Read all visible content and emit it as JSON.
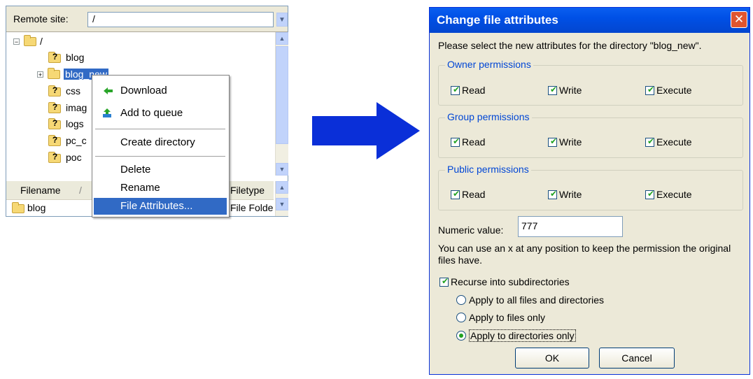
{
  "filezilla": {
    "remote_site_label": "Remote site:",
    "remote_site_value": "/",
    "tree": [
      {
        "label": "/",
        "expander": "−"
      },
      {
        "label": "blog"
      },
      {
        "label": "blog_new",
        "expander": "+",
        "selected": true
      },
      {
        "label": "css"
      },
      {
        "label": "imag"
      },
      {
        "label": "logs"
      },
      {
        "label": "pc_c"
      },
      {
        "label": "poc"
      }
    ],
    "columns": {
      "filename": "Filename",
      "sort_indicator": "/",
      "filetype": "Filetype"
    },
    "rows": [
      {
        "filename": "blog",
        "filetype": "File Folde"
      }
    ]
  },
  "context_menu": {
    "items": [
      {
        "label": "Download",
        "icon": "download-arrow-icon"
      },
      {
        "label": "Add to queue",
        "icon": "add-to-queue-icon"
      },
      {
        "label": "Create directory"
      },
      {
        "label": "Delete"
      },
      {
        "label": "Rename"
      },
      {
        "label": "File Attributes...",
        "highlighted": true
      }
    ]
  },
  "arrow": {
    "color": "#0a2fd8",
    "icon": "right-arrow-icon"
  },
  "dialog": {
    "title": "Change file attributes",
    "close_label": "✕",
    "description": "Please select the new attributes for the directory \"blog_new\".",
    "groups": [
      {
        "title": "Owner permissions",
        "read": "Read",
        "write": "Write",
        "execute": "Execute",
        "read_checked": true,
        "write_checked": true,
        "execute_checked": true
      },
      {
        "title": "Group permissions",
        "read": "Read",
        "write": "Write",
        "execute": "Execute",
        "read_checked": true,
        "write_checked": true,
        "execute_checked": true
      },
      {
        "title": "Public permissions",
        "read": "Read",
        "write": "Write",
        "execute": "Execute",
        "read_checked": true,
        "write_checked": true,
        "execute_checked": true
      }
    ],
    "numeric_label": "Numeric value:",
    "numeric_value": "777",
    "hint": "You can use an x at any position to keep the permission the original files have.",
    "recurse_label": "Recurse into subdirectories",
    "recurse_checked": true,
    "apply_options": [
      {
        "label": "Apply to all files and directories",
        "selected": false
      },
      {
        "label": "Apply to files only",
        "selected": false
      },
      {
        "label": "Apply to directories only",
        "selected": true
      }
    ],
    "ok_label": "OK",
    "cancel_label": "Cancel"
  },
  "colors": {
    "title_bar": "#0050e6",
    "selection": "#316ac5",
    "group_title": "#0046d5",
    "dialog_bg": "#ece9d8"
  }
}
